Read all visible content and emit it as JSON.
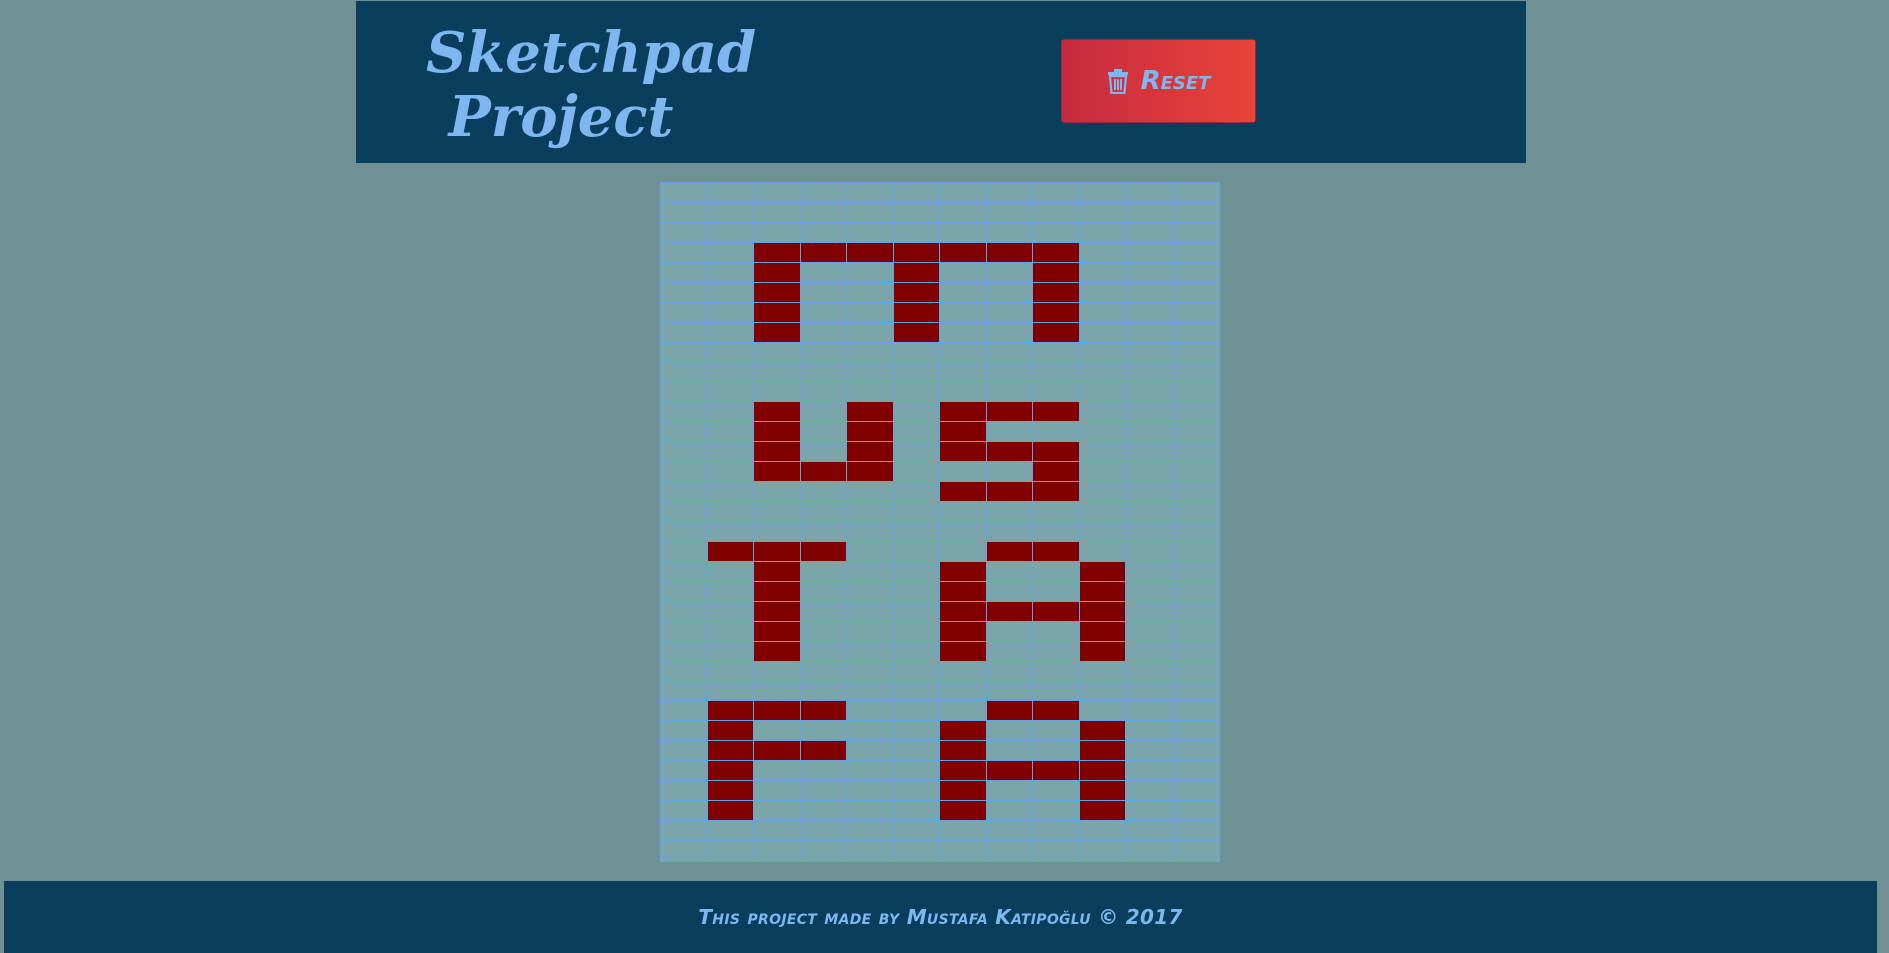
{
  "header": {
    "title_line1": "Sketchpad",
    "title_line2": "Project",
    "reset_label": "Reset",
    "reset_icon": "trash-icon"
  },
  "sketchpad": {
    "columns": 12,
    "rows": 34,
    "fill_color": "#800000",
    "grid_line_color": "#5fa5e6",
    "painted_cells": [
      [
        3,
        2
      ],
      [
        3,
        3
      ],
      [
        3,
        4
      ],
      [
        3,
        5
      ],
      [
        3,
        6
      ],
      [
        3,
        7
      ],
      [
        3,
        8
      ],
      [
        4,
        2
      ],
      [
        4,
        5
      ],
      [
        4,
        8
      ],
      [
        5,
        2
      ],
      [
        5,
        5
      ],
      [
        5,
        8
      ],
      [
        6,
        2
      ],
      [
        6,
        5
      ],
      [
        6,
        8
      ],
      [
        7,
        2
      ],
      [
        7,
        5
      ],
      [
        7,
        8
      ],
      [
        11,
        2
      ],
      [
        11,
        4
      ],
      [
        11,
        6
      ],
      [
        11,
        7
      ],
      [
        11,
        8
      ],
      [
        12,
        2
      ],
      [
        12,
        4
      ],
      [
        12,
        6
      ],
      [
        13,
        2
      ],
      [
        13,
        4
      ],
      [
        13,
        6
      ],
      [
        13,
        7
      ],
      [
        13,
        8
      ],
      [
        14,
        2
      ],
      [
        14,
        3
      ],
      [
        14,
        4
      ],
      [
        14,
        8
      ],
      [
        15,
        6
      ],
      [
        15,
        7
      ],
      [
        15,
        8
      ],
      [
        18,
        1
      ],
      [
        18,
        2
      ],
      [
        18,
        3
      ],
      [
        18,
        7
      ],
      [
        18,
        8
      ],
      [
        19,
        2
      ],
      [
        19,
        6
      ],
      [
        19,
        9
      ],
      [
        20,
        2
      ],
      [
        20,
        6
      ],
      [
        20,
        9
      ],
      [
        21,
        2
      ],
      [
        21,
        6
      ],
      [
        21,
        7
      ],
      [
        21,
        8
      ],
      [
        21,
        9
      ],
      [
        22,
        2
      ],
      [
        22,
        6
      ],
      [
        22,
        9
      ],
      [
        23,
        2
      ],
      [
        23,
        6
      ],
      [
        23,
        9
      ],
      [
        26,
        1
      ],
      [
        26,
        2
      ],
      [
        26,
        3
      ],
      [
        26,
        7
      ],
      [
        26,
        8
      ],
      [
        27,
        1
      ],
      [
        27,
        6
      ],
      [
        27,
        9
      ],
      [
        28,
        1
      ],
      [
        28,
        2
      ],
      [
        28,
        3
      ],
      [
        28,
        6
      ],
      [
        28,
        9
      ],
      [
        29,
        1
      ],
      [
        29,
        6
      ],
      [
        29,
        7
      ],
      [
        29,
        8
      ],
      [
        29,
        9
      ],
      [
        30,
        1
      ],
      [
        30,
        6
      ],
      [
        30,
        9
      ],
      [
        31,
        1
      ],
      [
        31,
        6
      ],
      [
        31,
        9
      ]
    ]
  },
  "footer": {
    "text": "This project made by Mustafa Katipoğlu © 2017"
  }
}
